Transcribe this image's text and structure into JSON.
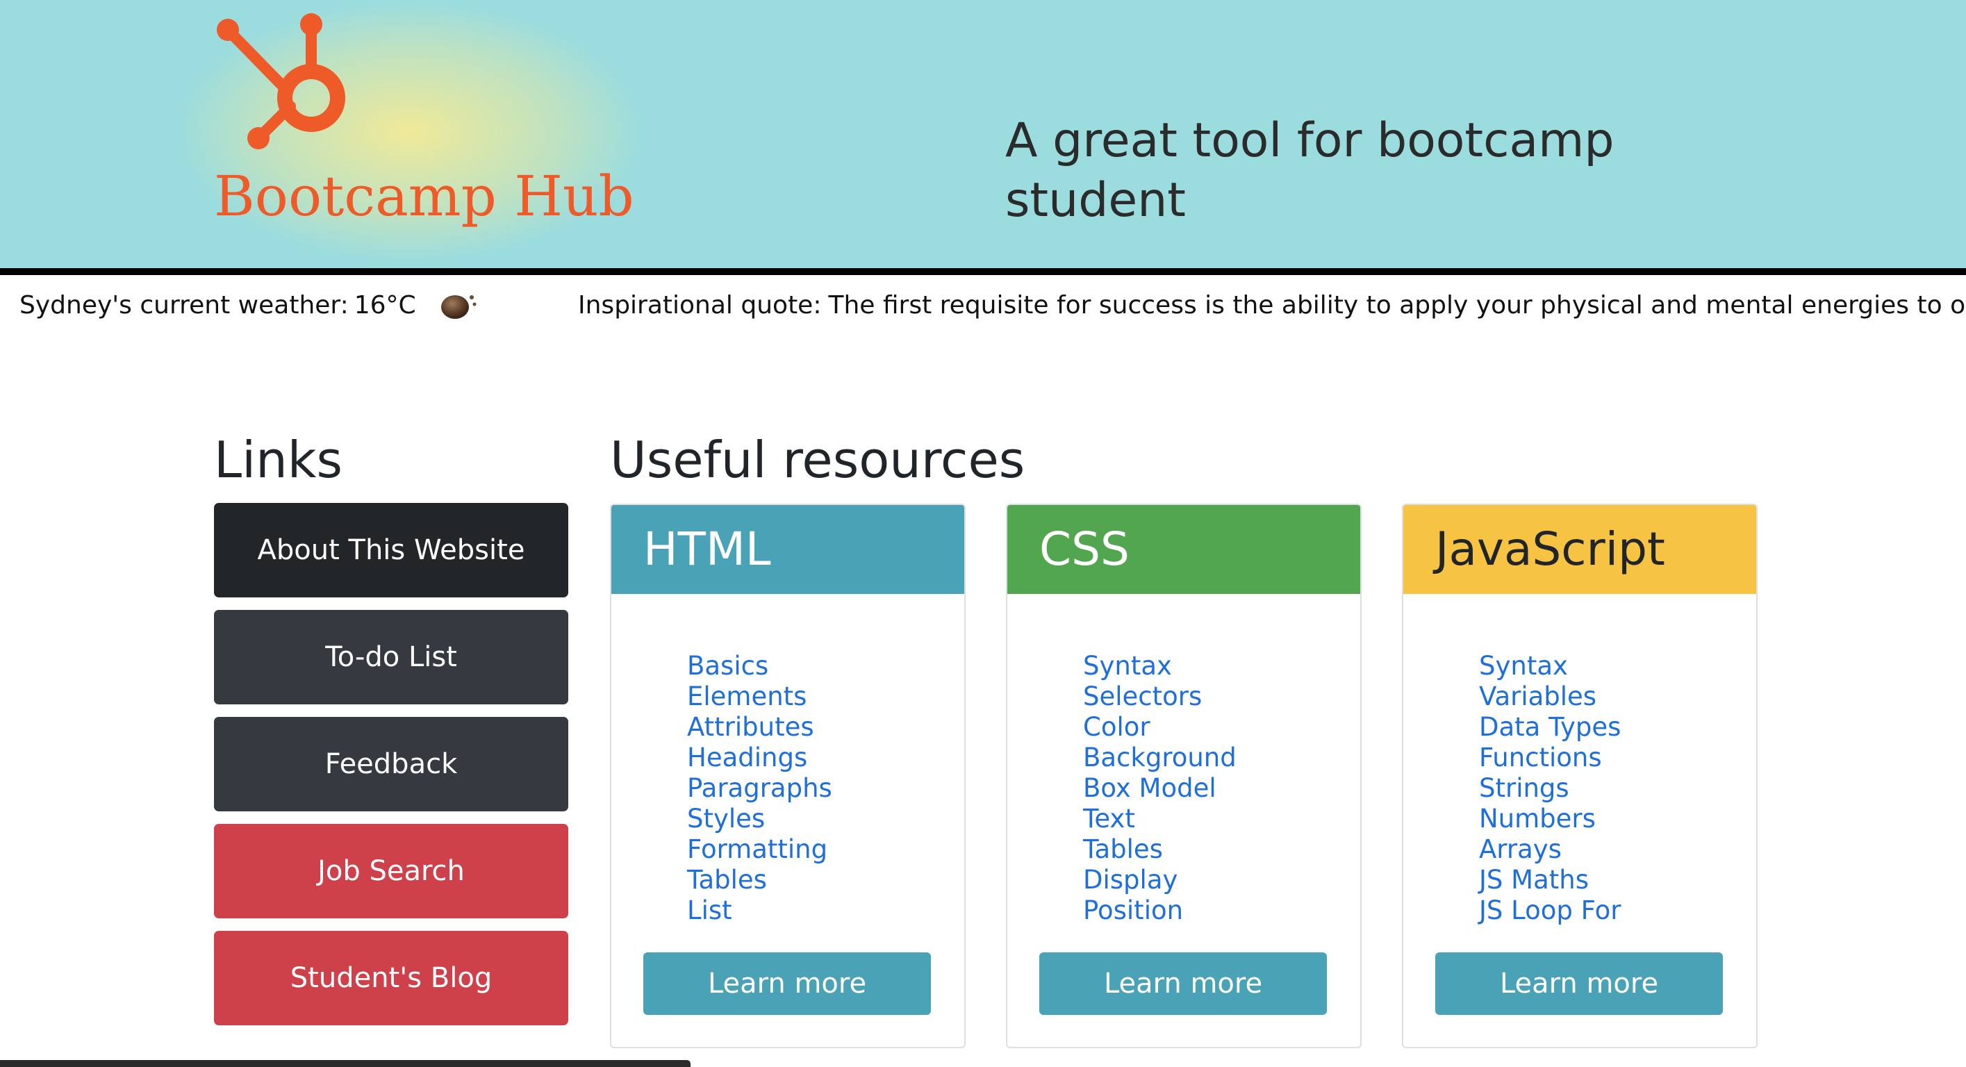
{
  "header": {
    "logo_text": "Bootcamp Hub",
    "tagline": "A great tool for bootcamp student",
    "brand_color": "#ef5a29",
    "background_color": "#9bdcdf"
  },
  "weather": {
    "label": "Sydney's current weather:",
    "temperature": "16°C",
    "icon": "overcast-cloud-icon"
  },
  "quote": {
    "label": "Inspirational quote:",
    "text": "The first requisite for success is the ability to apply your physical and mental energies to one proble"
  },
  "links": {
    "heading": "Links",
    "buttons": [
      {
        "label": "About This Website",
        "color": "#232629"
      },
      {
        "label": "To-do List",
        "color": "#343a40"
      },
      {
        "label": "Feedback",
        "color": "#343a40"
      },
      {
        "label": "Job Search",
        "color": "#cf414a"
      },
      {
        "label": "Student's Blog",
        "color": "#cf414a"
      }
    ]
  },
  "resources": {
    "heading": "Useful resources",
    "cards": [
      {
        "title": "HTML",
        "color": "#4aa2b6",
        "items": [
          "Basics",
          "Elements",
          "Attributes",
          "Headings",
          "Paragraphs",
          "Styles",
          "Formatting",
          "Tables",
          "List"
        ],
        "button_label": "Learn more"
      },
      {
        "title": "CSS",
        "color": "#52a650",
        "items": [
          "Syntax",
          "Selectors",
          "Color",
          "Background",
          "Box Model",
          "Text",
          "Tables",
          "Display",
          "Position"
        ],
        "button_label": "Learn more"
      },
      {
        "title": "JavaScript",
        "color": "#f6c343",
        "items": [
          "Syntax",
          "Variables",
          "Data Types",
          "Functions",
          "Strings",
          "Numbers",
          "Arrays",
          "JS Maths",
          "JS Loop For"
        ],
        "button_label": "Learn more"
      }
    ]
  }
}
